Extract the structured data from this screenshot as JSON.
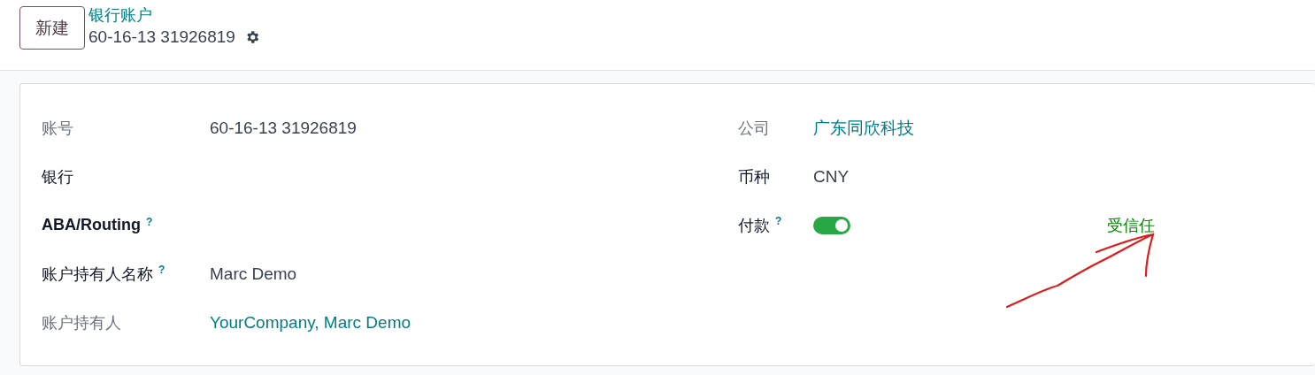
{
  "control_panel": {
    "new_button": "新建",
    "breadcrumb": "银行账户",
    "record_title": "60-16-13 31926819"
  },
  "left_fields": [
    {
      "label": "账号",
      "muted": true,
      "bold": false,
      "value": "60-16-13 31926819",
      "link": false
    },
    {
      "label": "银行",
      "muted": false,
      "bold": false
    },
    {
      "label": "ABA/Routing",
      "muted": false,
      "bold": true,
      "help_mark": "?"
    },
    {
      "label": "账户持有人名称",
      "muted": false,
      "bold": false,
      "help_mark": "?",
      "value": "Marc Demo",
      "link": false
    },
    {
      "label": "账户持有人",
      "muted": true,
      "bold": false,
      "value": "YourCompany, Marc Demo",
      "link": true
    }
  ],
  "right_fields": [
    {
      "kind": "text",
      "label": "公司",
      "muted": true,
      "bold": false,
      "value": "广东同欣科技",
      "link": true
    },
    {
      "kind": "text",
      "label": "币种",
      "muted": false,
      "bold": false,
      "value": "CNY",
      "link": false
    },
    {
      "kind": "toggle",
      "label": "付款",
      "muted": false,
      "bold": false,
      "help_mark": "?",
      "on": true,
      "status": "受信任"
    }
  ]
}
